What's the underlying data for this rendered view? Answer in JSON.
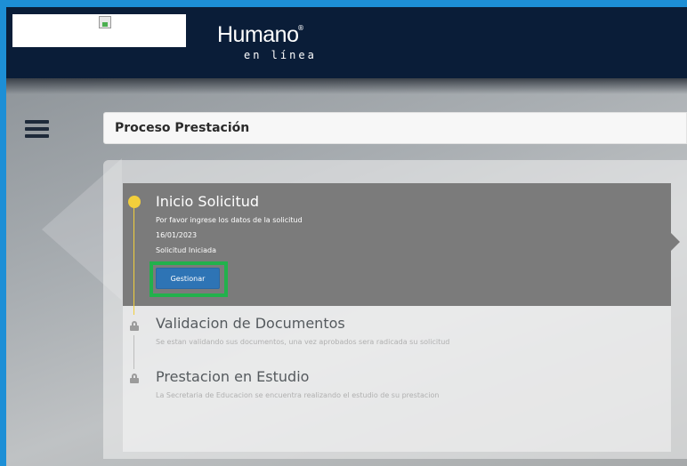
{
  "header": {
    "logo_main": "Humano",
    "logo_mark": "®",
    "logo_sub": "en línea"
  },
  "page": {
    "title": "Proceso Prestación"
  },
  "steps": [
    {
      "title": "Inicio Solicitud",
      "description": "Por favor ingrese los datos de la solicitud",
      "date": "16/01/2023",
      "status": "Solicitud Iniciada",
      "button_label": "Gestionar",
      "state": "active"
    },
    {
      "title": "Validacion de Documentos",
      "description": "Se estan validando sus documentos, una vez aprobados sera radicada su solicitud",
      "state": "locked"
    },
    {
      "title": "Prestacion en Estudio",
      "description": "La Secretaria de Educacion se encuentra realizando el estudio de su prestacion",
      "state": "locked"
    }
  ],
  "icons": {
    "menu": "hamburger-menu-icon",
    "lock": "lock-icon",
    "status_dot": "status-dot-icon",
    "broken_image": "broken-image-icon"
  },
  "colors": {
    "header_bg": "#0a1d38",
    "active_step_bg": "#7b7b7b",
    "active_dot": "#f2cf3c",
    "button_bg": "#2e74b5",
    "highlight_border": "#22b14c"
  }
}
